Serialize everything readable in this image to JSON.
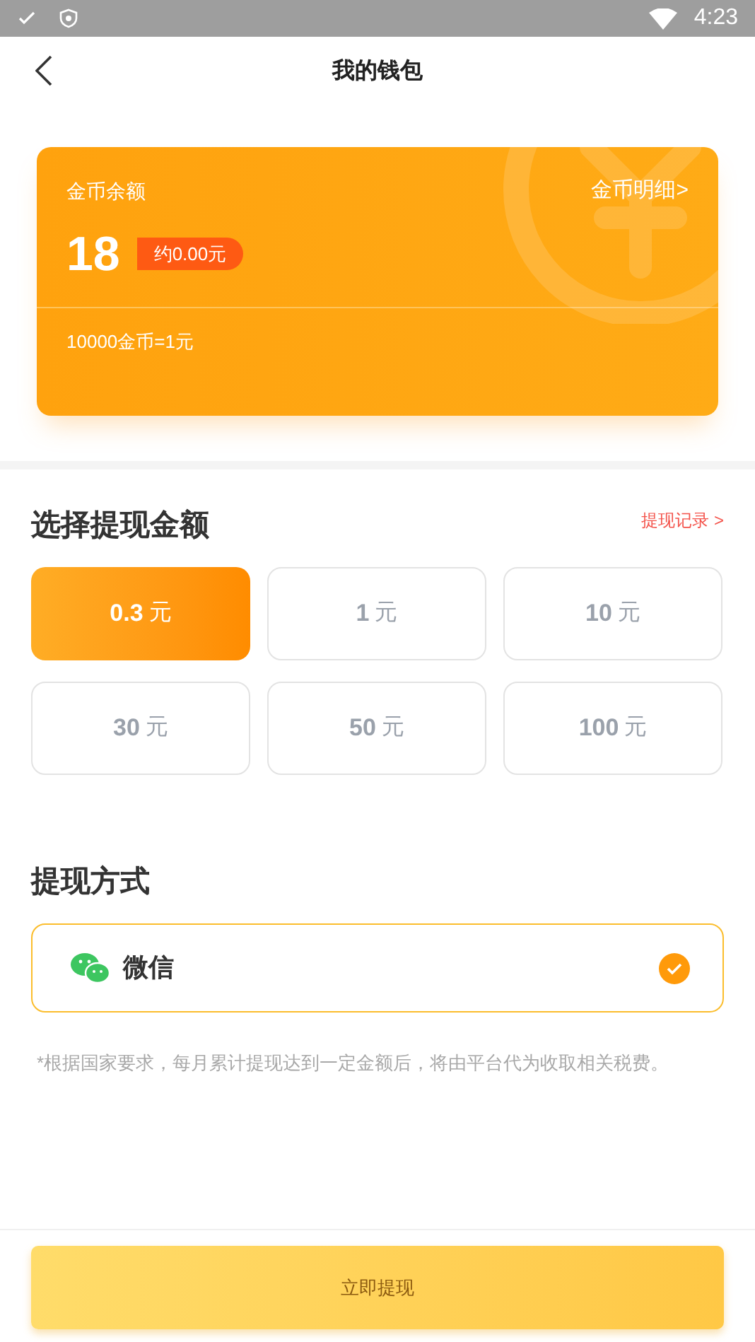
{
  "status_bar": {
    "time": "4:23"
  },
  "header": {
    "title": "我的钱包"
  },
  "card": {
    "label": "金币余额",
    "detail_link": "金币明细>",
    "balance": "18",
    "approx": "约0.00元",
    "rate": "10000金币=1元"
  },
  "amounts": {
    "title": "选择提现金额",
    "history_link": "提现记录 >",
    "options": [
      {
        "amount": "0.3",
        "unit": "元",
        "selected": true
      },
      {
        "amount": "1",
        "unit": "元",
        "selected": false
      },
      {
        "amount": "10",
        "unit": "元",
        "selected": false
      },
      {
        "amount": "30",
        "unit": "元",
        "selected": false
      },
      {
        "amount": "50",
        "unit": "元",
        "selected": false
      },
      {
        "amount": "100",
        "unit": "元",
        "selected": false
      }
    ]
  },
  "methods": {
    "title": "提现方式",
    "options": [
      {
        "label": "微信",
        "selected": true
      }
    ]
  },
  "note": "*根据国家要求，每月累计提现达到一定金额后，将由平台代为收取相关税费。",
  "submit": "立即提现"
}
